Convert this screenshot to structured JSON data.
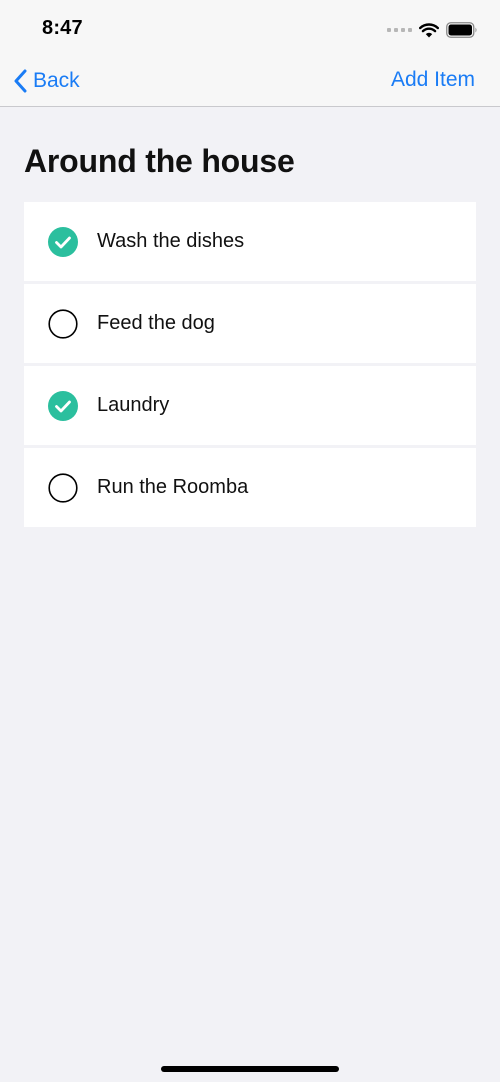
{
  "status_bar": {
    "time": "8:47",
    "icons": [
      "signal-dots-icon",
      "wifi-icon",
      "battery-icon"
    ]
  },
  "nav": {
    "back_label": "Back",
    "add_label": "Add Item"
  },
  "page": {
    "title": "Around the house"
  },
  "tasks": [
    {
      "label": "Wash the dishes",
      "done": true
    },
    {
      "label": "Feed the dog",
      "done": false
    },
    {
      "label": "Laundry",
      "done": true
    },
    {
      "label": "Run the Roomba",
      "done": false
    }
  ],
  "colors": {
    "accent": "#1a7cf5",
    "check": "#2bbf9e",
    "background": "#f2f2f6",
    "row": "#ffffff"
  }
}
